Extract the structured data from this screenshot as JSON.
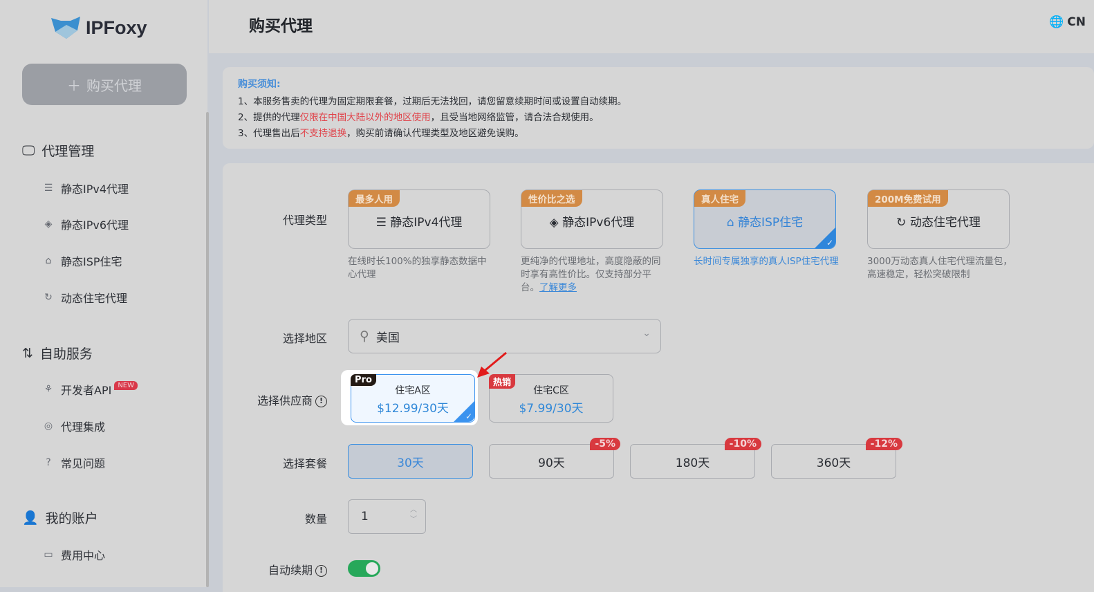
{
  "brand": {
    "name": "IPFoxy"
  },
  "sidebar": {
    "buy_button": "购买代理",
    "groups": [
      {
        "label": "代理管理",
        "items": [
          "静态IPv4代理",
          "静态IPv6代理",
          "静态ISP住宅",
          "动态住宅代理"
        ]
      },
      {
        "label": "自助服务",
        "items": [
          "开发者API",
          "代理集成",
          "常见问题"
        ],
        "badge": "NEW"
      },
      {
        "label": "我的账户",
        "items": [
          "费用中心"
        ]
      }
    ]
  },
  "header": {
    "title": "购买代理",
    "lang": "CN"
  },
  "notice": {
    "heading": "购买须知:",
    "l1": "1、本服务售卖的代理为固定期限套餐，过期后无法找回，请您留意续期时间或设置自动续期。",
    "l2a": "2、提供的代理",
    "l2b": "仅限在中国大陆以外的地区使用",
    "l2c": "，且受当地网络监管，请合法合规使用。",
    "l3a": "3、代理售出后",
    "l3b": "不支持退换",
    "l3c": "，购买前请确认代理类型及地区避免误购。"
  },
  "form": {
    "type_label": "代理类型",
    "region_label": "选择地区",
    "supplier_label": "选择供应商",
    "package_label": "选择套餐",
    "qty_label": "数量",
    "renew_label": "自动续期",
    "types": [
      {
        "tag": "最多人用",
        "name": "静态IPv4代理",
        "desc": "在线时长100%的独享静态数据中心代理"
      },
      {
        "tag": "性价比之选",
        "name": "静态IPv6代理",
        "desc": "更纯净的代理地址，高度隐蔽的同时享有高性价比。仅支持部分平台。",
        "link": "了解更多"
      },
      {
        "tag": "真人住宅",
        "name": "静态ISP住宅",
        "desc": "长时间专属独享的真人ISP住宅代理",
        "selected": true
      },
      {
        "tag": "200M免费试用",
        "name": "动态住宅代理",
        "desc": "3000万动态真人住宅代理流量包，高速稳定，轻松突破限制"
      }
    ],
    "region_value": "美国",
    "suppliers": [
      {
        "tag": "Pro",
        "name": "住宅A区",
        "price": "$12.99/30天",
        "selected": true
      },
      {
        "tag": "热销",
        "name": "住宅C区",
        "price": "$7.99/30天"
      }
    ],
    "packages": [
      {
        "label": "30天",
        "selected": true
      },
      {
        "label": "90天",
        "discount": "-5%"
      },
      {
        "label": "180天",
        "discount": "-10%"
      },
      {
        "label": "360天",
        "discount": "-12%"
      }
    ],
    "quantity": "1",
    "auto_renew": true
  },
  "colors": {
    "accent": "#3b8fe0",
    "tag": "#d28a45",
    "danger": "#d8393f",
    "toggle": "#27a85a"
  }
}
